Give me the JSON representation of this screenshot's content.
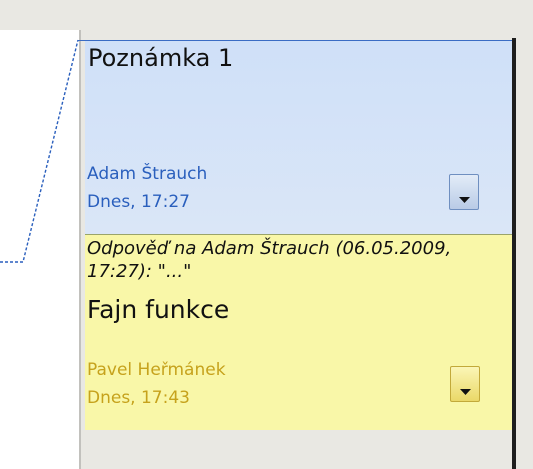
{
  "comments": [
    {
      "title": "Poznámka 1",
      "author": "Adam Štrauch",
      "time": "Dnes, 17:27",
      "menu_icon": "triangle-down-icon",
      "color": "#cfe0f8",
      "author_color": "#2a5fbd"
    },
    {
      "reply_header": "Odpověď na Adam Štrauch (06.05.2009, 17:27): \"...\"",
      "body": "Fajn funkce",
      "author": "Pavel Heřmánek",
      "time": "Dnes, 17:43",
      "menu_icon": "triangle-down-icon",
      "color": "#f9f7a8",
      "author_color": "#c6a21c"
    }
  ],
  "colors": {
    "background": "#e9e8e3",
    "page": "#ffffff",
    "anchor_line": "#2a5fbd"
  }
}
